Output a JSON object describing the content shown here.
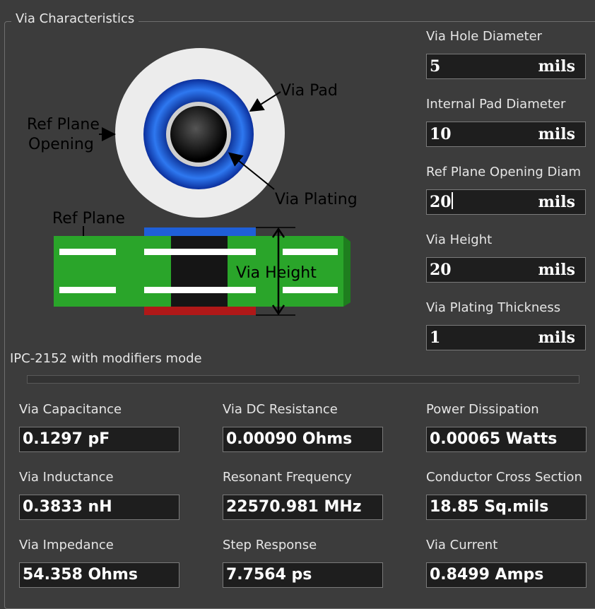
{
  "group_title": "Via Characteristics",
  "inputs": [
    {
      "label": "Via Hole Diameter",
      "value": "5",
      "unit": "mils"
    },
    {
      "label": "Internal Pad Diameter",
      "value": "10",
      "unit": "mils"
    },
    {
      "label": "Ref Plane Opening Diam",
      "value": "20",
      "unit": "mils"
    },
    {
      "label": "Via Height",
      "value": "20",
      "unit": "mils"
    },
    {
      "label": "Via Plating Thickness",
      "value": "1",
      "unit": "mils"
    }
  ],
  "diagram": {
    "via_pad": "Via Pad",
    "ref_plane_opening_line1": "Ref Plane",
    "ref_plane_opening_line2": "Opening",
    "via_plating": "Via Plating",
    "ref_plane": "Ref Plane",
    "via_height": "Via Height"
  },
  "mode_text": "IPC-2152 with modifiers mode",
  "results": [
    {
      "label": "Via Capacitance",
      "value": "0.1297 pF"
    },
    {
      "label": "Via DC Resistance",
      "value": "0.00090 Ohms"
    },
    {
      "label": "Power Dissipation",
      "value": "0.00065 Watts"
    },
    {
      "label": "Via Inductance",
      "value": "0.3833 nH"
    },
    {
      "label": "Resonant Frequency",
      "value": "22570.981 MHz"
    },
    {
      "label": "Conductor Cross Section",
      "value": "18.85 Sq.mils"
    },
    {
      "label": "Via Impedance",
      "value": "54.358 Ohms"
    },
    {
      "label": "Step Response",
      "value": "7.7564 ps"
    },
    {
      "label": "Via Current",
      "value": "0.8499 Amps"
    }
  ],
  "colors": {
    "background": "#3c3c3c",
    "field_bg": "#1e1e1e",
    "pcb_green": "#2aa52a",
    "via_blue": "#1f5fd8",
    "bottom_pad_red": "#b01818"
  }
}
